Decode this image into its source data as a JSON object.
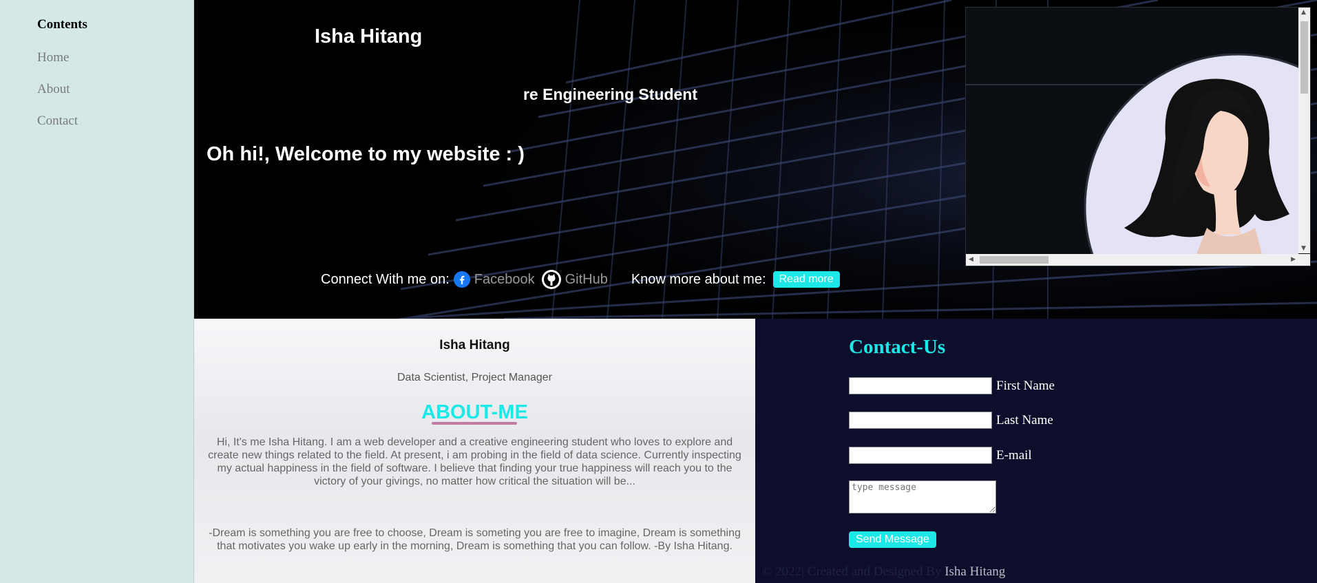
{
  "sidebar": {
    "title": "Contents",
    "items": [
      {
        "label": "Home"
      },
      {
        "label": "About"
      },
      {
        "label": "Contact"
      }
    ]
  },
  "hero": {
    "name": "Isha Hitang",
    "role": "re Engineering Student",
    "welcome": "Oh hi!, Welcome to my website : )",
    "connect_label": "Connect With me on:",
    "facebook_label": "Facebook",
    "github_label": "GitHub",
    "know_more_label": "Know more about me:",
    "read_more_button": "Read more",
    "icons": [
      "facebook-icon",
      "github-icon"
    ]
  },
  "about": {
    "name": "Isha Hitang",
    "role": "Data Scientist, Project Manager",
    "heading": "ABOUT-ME",
    "text": "Hi, It's me Isha Hitang. I am a web developer and a creative engineering student who loves to explore and create new things related to the field. At present, i am probing in the field of data science. Currently inspecting my actual happiness in the field of software. I believe that finding your true happiness will reach you to the victory of your givings, no matter how critical the situation will be...",
    "quote": "-Dream is something you are free to choose, Dream is someting you are free to imagine, Dream is something that motivates you wake up early in the morning, Dream is something that you can follow. -By Isha Hitang."
  },
  "contact": {
    "heading": "Contact-Us",
    "first_name_label": "First Name",
    "last_name_label": "Last Name",
    "email_label": "E-mail",
    "message_placeholder": "type message",
    "send_button": "Send Message",
    "footer_text": "© 2022| Created and Designed By",
    "footer_author": "Isha Hitang"
  },
  "colors": {
    "accent": "#1de8e8",
    "sidebar_bg": "#d5e8e8",
    "contact_bg": "#0d0e2b",
    "hero_bg": "#000000",
    "underline": "#c47aa6"
  }
}
